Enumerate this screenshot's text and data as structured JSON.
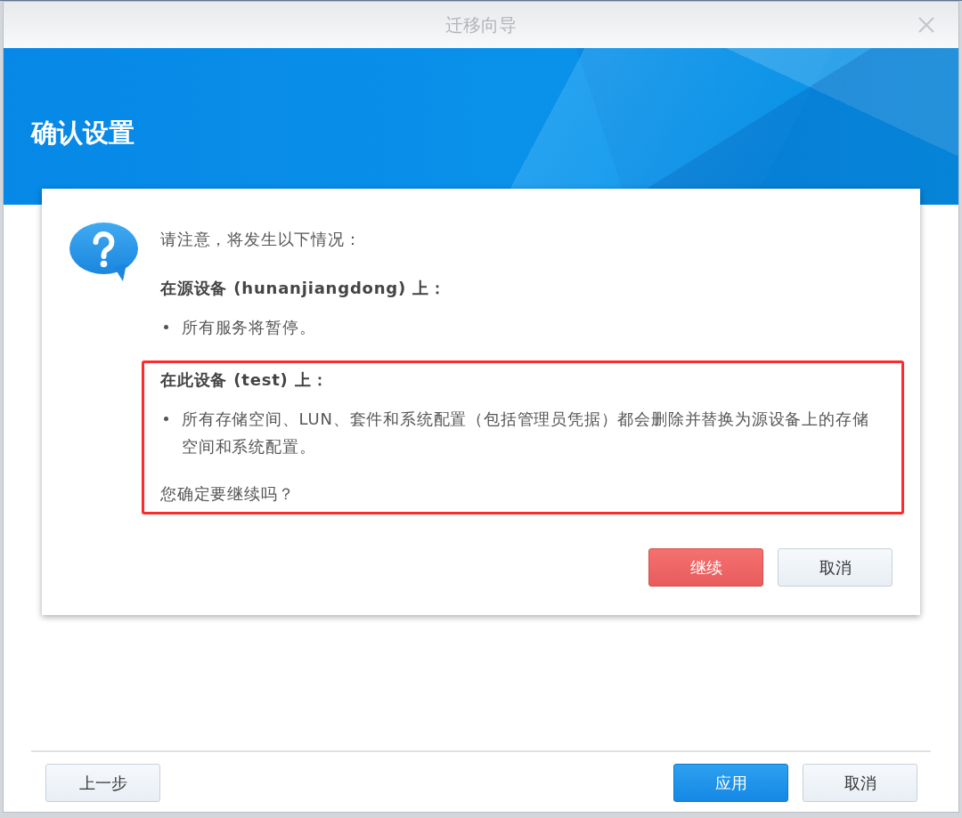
{
  "window": {
    "title": "迁移向导"
  },
  "header": {
    "title": "确认设置"
  },
  "message": {
    "blocks": [
      {
        "kind": "text",
        "text": "请注意，将发生以下情况：",
        "highlighted": false
      },
      {
        "kind": "section",
        "heading": "在源设备 (hunanjiangdong) 上：",
        "bullets": [
          "所有服务将暂停。"
        ],
        "highlighted": false
      },
      {
        "kind": "section",
        "heading": "在此设备 (test) 上：",
        "bullets": [
          "所有存储空间、LUN、套件和系统配置（包括管理员凭据）都会删除并替换为源设备上的存储空间和系统配置。"
        ],
        "highlighted": true
      },
      {
        "kind": "text",
        "text": "您确定要继续吗？",
        "highlighted": true
      }
    ]
  },
  "dialog_buttons": [
    {
      "label": "继续",
      "kind": "danger"
    },
    {
      "label": "取消",
      "kind": "default"
    }
  ],
  "footer_buttons": [
    {
      "label": "上一步",
      "kind": "default"
    },
    {
      "label": "应用",
      "kind": "primary"
    },
    {
      "label": "取消",
      "kind": "default"
    }
  ]
}
